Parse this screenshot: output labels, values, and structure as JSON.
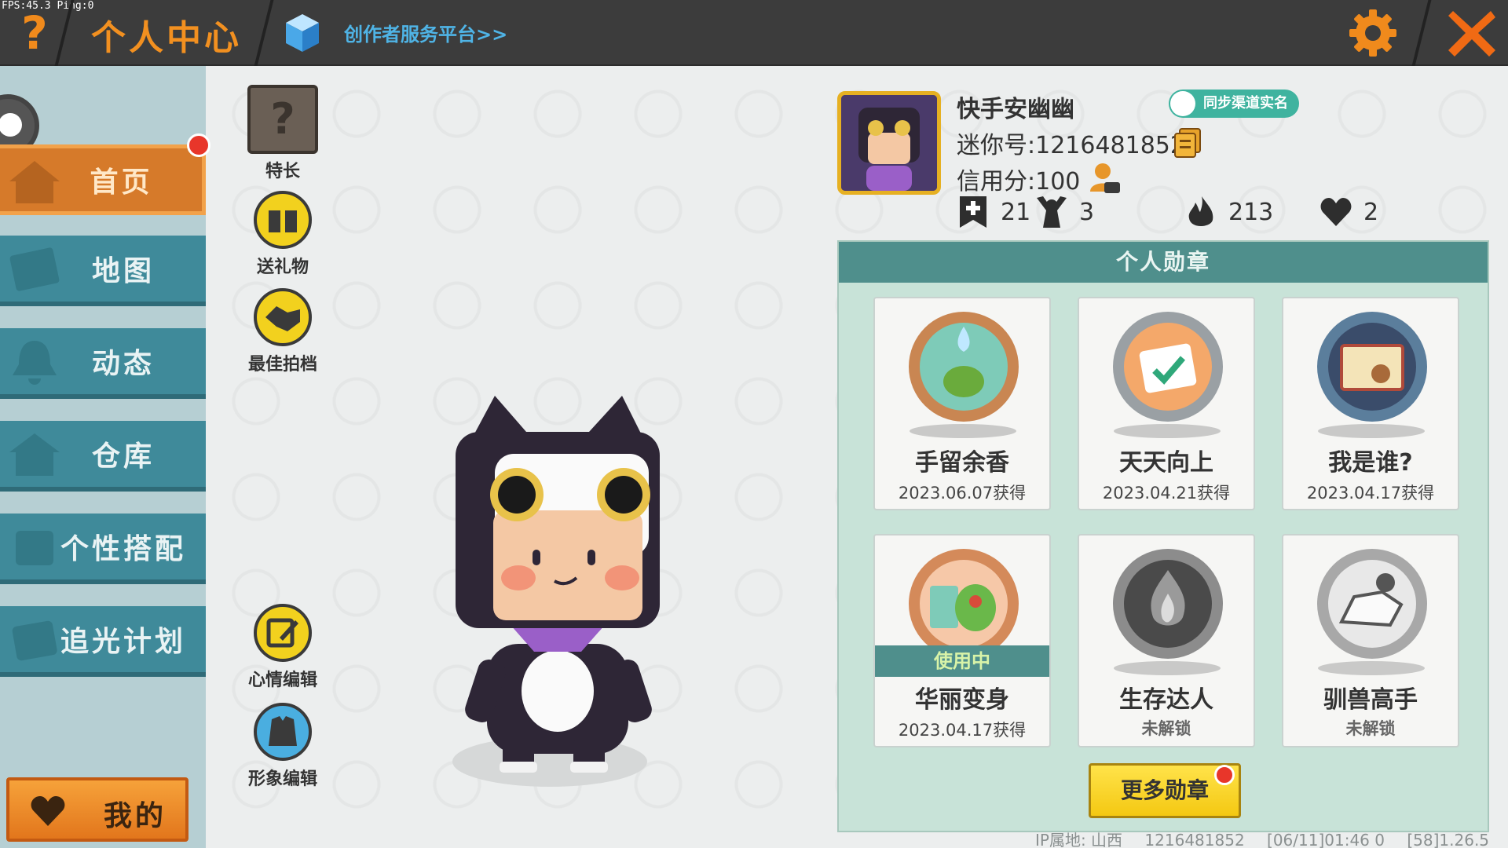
{
  "debug": {
    "fps_text": "FPS:45.3  Ping:0"
  },
  "header": {
    "title": "个人中心",
    "creator_link": "创作者服务平台>>",
    "help_glyph": "?",
    "icons": [
      "help-icon",
      "cube-icon",
      "gear-icon",
      "close-icon"
    ],
    "accent_color": "#f29020"
  },
  "sidebar": {
    "items": [
      {
        "label": "首页",
        "icon": "home-icon",
        "active": true
      },
      {
        "label": "地图",
        "icon": "map-icon",
        "active": false
      },
      {
        "label": "动态",
        "icon": "bell-icon",
        "active": false
      },
      {
        "label": "仓库",
        "icon": "house-icon",
        "active": false
      },
      {
        "label": "个性搭配",
        "icon": "style-icon",
        "active": false
      },
      {
        "label": "追光计划",
        "icon": "light-icon",
        "active": false
      }
    ],
    "my_button": "我的"
  },
  "actions": [
    {
      "label": "特长",
      "icon": "question-box-icon"
    },
    {
      "label": "送礼物",
      "icon": "gift-icon"
    },
    {
      "label": "最佳拍档",
      "icon": "handshake-icon"
    },
    {
      "label": "心情编辑",
      "icon": "edit-icon"
    },
    {
      "label": "形象编辑",
      "icon": "outfit-icon"
    }
  ],
  "profile": {
    "username": "快手安幽幽",
    "realname_badge": "同步渠道实名",
    "mini_id": "迷你号:1216481852",
    "credit": "信用分:100",
    "stats": {
      "plus": "21",
      "fans": "3",
      "fire": "213",
      "likes": "2"
    }
  },
  "medals": {
    "header": "个人勋章",
    "items": [
      {
        "name": "手留余香",
        "date": "2023.06.07获得",
        "locked": false,
        "in_use": false
      },
      {
        "name": "天天向上",
        "date": "2023.04.21获得",
        "locked": false,
        "in_use": false
      },
      {
        "name": "我是谁?",
        "date": "2023.04.17获得",
        "locked": false,
        "in_use": false
      },
      {
        "name": "华丽变身",
        "date": "2023.04.17获得",
        "locked": false,
        "in_use": true
      },
      {
        "name": "生存达人",
        "date": "未解锁",
        "locked": true,
        "in_use": false
      },
      {
        "name": "驯兽高手",
        "date": "未解锁",
        "locked": true,
        "in_use": false
      }
    ],
    "in_use_label": "使用中",
    "more_button": "更多勋章"
  },
  "footer": {
    "ip_location": "IP属地: 山西",
    "uid": "1216481852",
    "time": "[06/11]01:46 0",
    "version": "[58]1.26.5"
  }
}
